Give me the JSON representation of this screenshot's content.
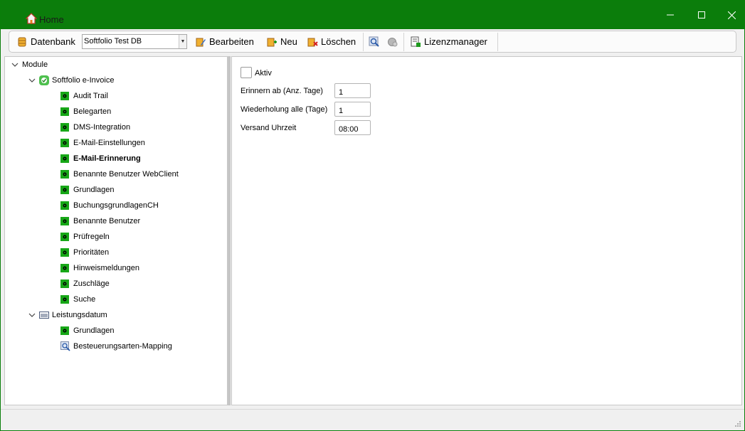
{
  "window": {
    "title": "Home",
    "accent": "#0b7d0b"
  },
  "toolbar": {
    "database_label": "Datenbank",
    "database_value": "Softfolio Test DB",
    "edit_label": "Bearbeiten",
    "new_label": "Neu",
    "delete_label": "Löschen",
    "license_label": "Lizenzmanager"
  },
  "tree": {
    "root": "Module",
    "groups": [
      {
        "label": "Softfolio e-Invoice",
        "items": [
          "Audit Trail",
          "Belegarten",
          "DMS-Integration",
          "E-Mail-Einstellungen",
          "E-Mail-Erinnerung",
          "Benannte Benutzer WebClient",
          "Grundlagen",
          "BuchungsgrundlagenCH",
          "Benannte Benutzer",
          "Prüfregeln",
          "Prioritäten",
          "Hinweismeldungen",
          "Zuschläge",
          "Suche"
        ]
      },
      {
        "label": "Leistungsdatum",
        "items": [
          "Grundlagen",
          "Besteuerungsarten-Mapping"
        ]
      }
    ],
    "selected": "E-Mail-Erinnerung"
  },
  "form": {
    "active_label": "Aktiv",
    "remind_label": "Erinnern ab (Anz. Tage)",
    "remind_value": "1",
    "repeat_label": "Wiederholung alle (Tage)",
    "repeat_value": "1",
    "send_time_label": "Versand Uhrzeit",
    "send_time_value": "08:00"
  }
}
